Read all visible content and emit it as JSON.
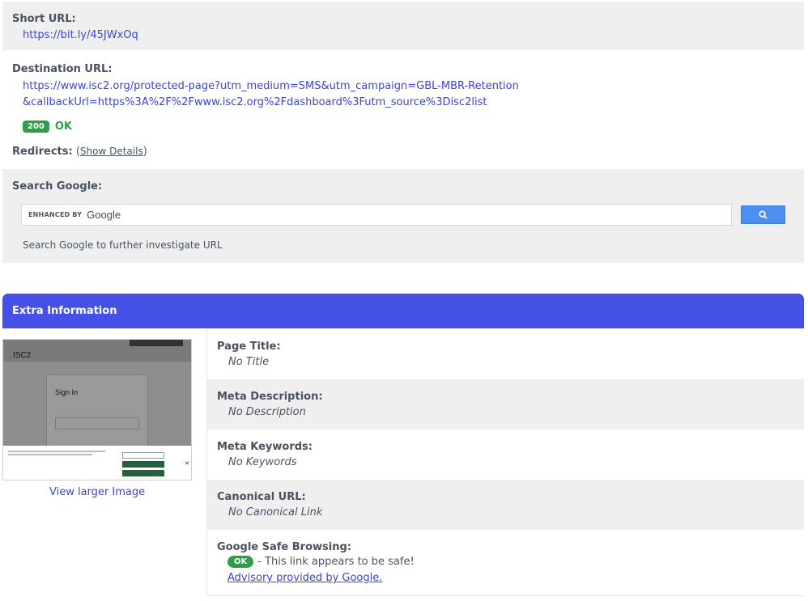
{
  "short_url": {
    "label": "Short URL:",
    "value": "https://bit.ly/45JWxOq"
  },
  "destination": {
    "label": "Destination URL:",
    "url": "https://www.isc2.org/protected-page?utm_medium=SMS&utm_campaign=GBL-MBR-Retention&callbackUrl=https%3A%2F%2Fwww.isc2.org%2Fdashboard%3Futm_source%3Disc2list",
    "status_code": "200",
    "status_text": "OK",
    "redirects_label": "Redirects:",
    "redirects_open": "(",
    "show_details": "Show Details",
    "redirects_close": ")"
  },
  "search": {
    "label": "Search Google:",
    "enhanced_by": "ENHANCED BY",
    "google": "Google",
    "hint": "Search Google to further investigate URL"
  },
  "extra": {
    "title": "Extra Information",
    "view_larger": "View larger Image",
    "thumbnail": {
      "brand": "ISC2",
      "sign_in": "Sign In"
    },
    "page_title": {
      "label": "Page Title:",
      "value": "No Title"
    },
    "meta_description": {
      "label": "Meta Description:",
      "value": "No Description"
    },
    "meta_keywords": {
      "label": "Meta Keywords:",
      "value": "No Keywords"
    },
    "canonical": {
      "label": "Canonical URL:",
      "value": "No Canonical Link"
    },
    "safe_browsing": {
      "label": "Google Safe Browsing:",
      "badge": "OK",
      "text": "- This link appears to be safe!",
      "advisory": "Advisory provided by Google."
    }
  },
  "colors": {
    "accent": "#4450e6",
    "link": "#3b44d4",
    "success": "#2f9e44",
    "search_button": "#4d8ff0"
  }
}
